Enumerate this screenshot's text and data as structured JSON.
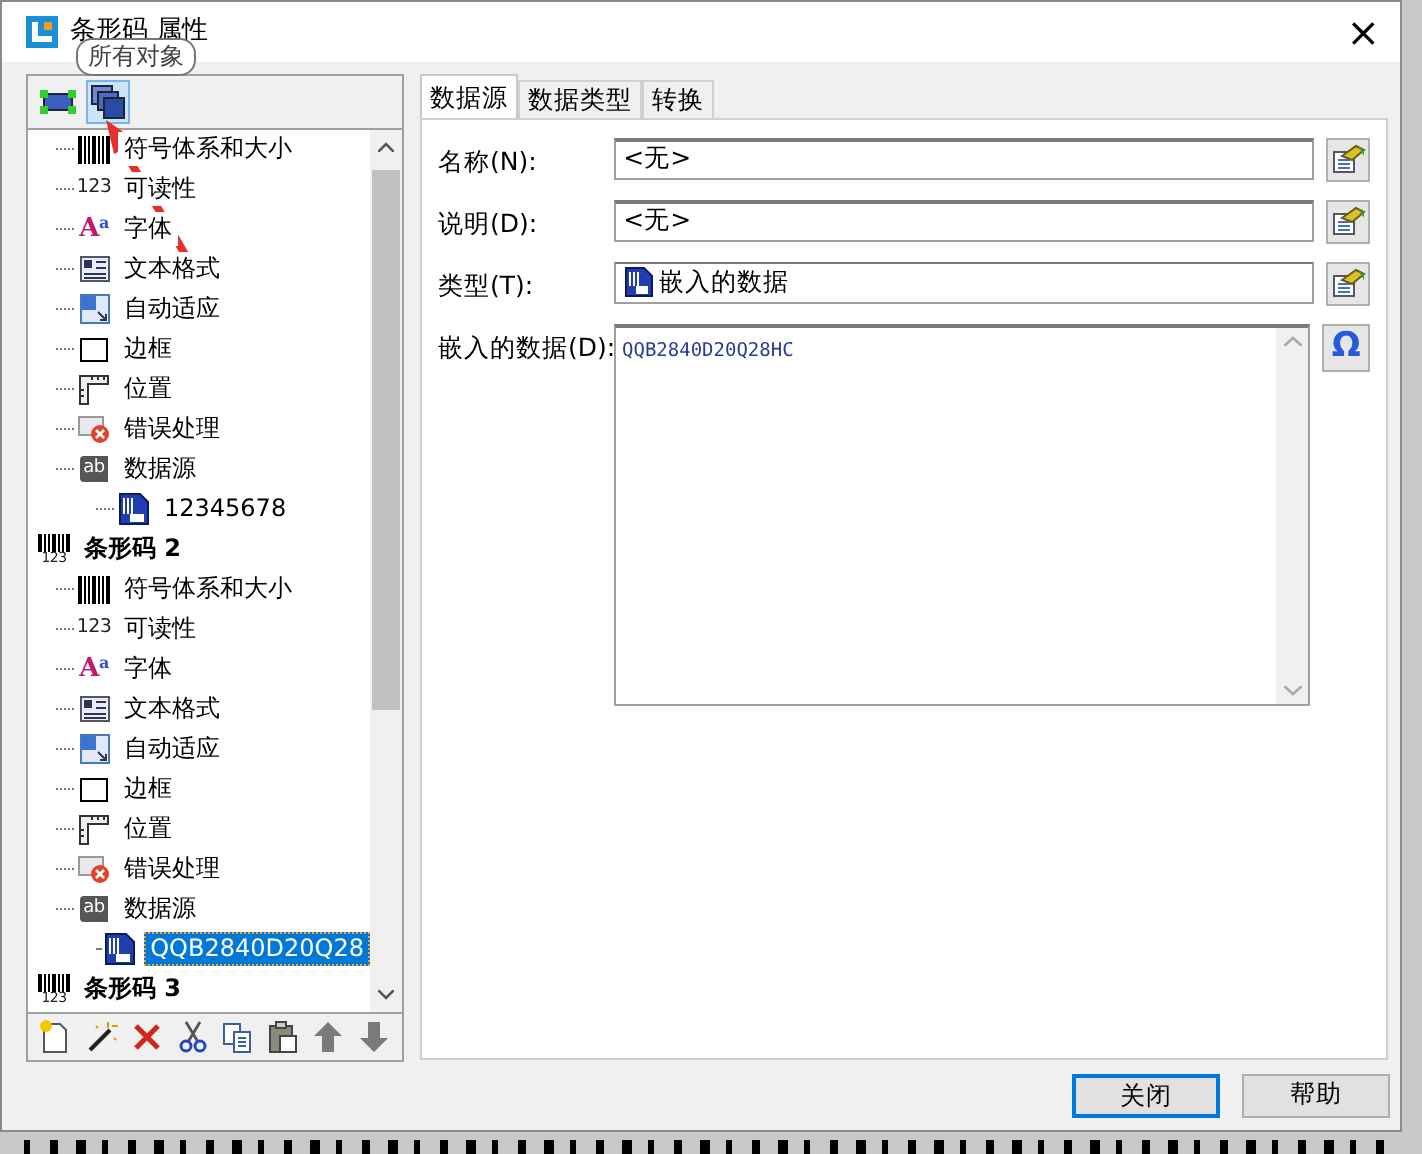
{
  "window": {
    "title": "条形码 属性",
    "close": "×"
  },
  "tooltip": "所有对象",
  "view_buttons": [
    {
      "kind": "object",
      "selected": false
    },
    {
      "kind": "all-objects",
      "selected": true
    }
  ],
  "tree": {
    "items": [
      {
        "kind": "hidden",
        "children": [
          {
            "kind": "symbology",
            "label": "符号体系和大小",
            "selected": false
          },
          {
            "kind": "readability",
            "label": "可读性",
            "icon_text": "123",
            "selected": false
          },
          {
            "kind": "font",
            "label": "字体",
            "icon_text": "A$^{a}$",
            "selected": false
          },
          {
            "kind": "text-format",
            "label": "文本格式",
            "selected": false
          },
          {
            "kind": "autofit",
            "label": "自动适应",
            "selected": false
          },
          {
            "kind": "border",
            "label": "边框",
            "selected": false
          },
          {
            "kind": "position",
            "label": "位置",
            "selected": false
          },
          {
            "kind": "error",
            "label": "错误处理",
            "selected": false
          },
          {
            "kind": "datasource",
            "label": "数据源",
            "icon_text": "ab",
            "selected": false,
            "children": [
              {
                "kind": "data",
                "label": "12345678",
                "selected": false
              }
            ]
          }
        ]
      },
      {
        "kind": "barcode",
        "label": "条形码 2",
        "icon_text": "123",
        "selected": false,
        "children": [
          {
            "kind": "symbology",
            "label": "符号体系和大小",
            "selected": false
          },
          {
            "kind": "readability",
            "label": "可读性",
            "icon_text": "123",
            "selected": false
          },
          {
            "kind": "font",
            "label": "字体",
            "icon_text": "A$^{a}$",
            "selected": false
          },
          {
            "kind": "text-format",
            "label": "文本格式",
            "selected": false
          },
          {
            "kind": "autofit",
            "label": "自动适应",
            "selected": false
          },
          {
            "kind": "border",
            "label": "边框",
            "selected": false
          },
          {
            "kind": "position",
            "label": "位置",
            "selected": false
          },
          {
            "kind": "error",
            "label": "错误处理",
            "selected": false
          },
          {
            "kind": "datasource",
            "label": "数据源",
            "icon_text": "ab",
            "selected": false,
            "children": [
              {
                "kind": "data",
                "label": "QQB2840D20Q28",
                "selected": true
              }
            ]
          }
        ]
      },
      {
        "kind": "barcode",
        "label": "条形码 3",
        "icon_text": "123",
        "selected": false
      }
    ]
  },
  "tabs": [
    {
      "label": "数据源",
      "selected": true
    },
    {
      "label": "数据类型",
      "selected": false
    },
    {
      "label": "转换",
      "selected": false
    }
  ],
  "fields": [
    {
      "kind": "text",
      "label": "名称(N):",
      "value": "<无>",
      "button": {
        "kind": "edit"
      }
    },
    {
      "kind": "text",
      "label": "说明(D):",
      "value": "<无>",
      "button": {
        "kind": "edit"
      }
    },
    {
      "kind": "type",
      "label": "类型(T):",
      "value": "嵌入的数据",
      "button": {
        "kind": "edit"
      }
    },
    {
      "kind": "multiline",
      "label": "嵌入的数据(D):",
      "value": "QQB2840D20Q28HC",
      "button": {
        "kind": "symbol",
        "text": "Ω"
      }
    }
  ],
  "buttons": [
    {
      "label": "关闭",
      "default": true
    },
    {
      "label": "帮助",
      "default": false
    }
  ]
}
